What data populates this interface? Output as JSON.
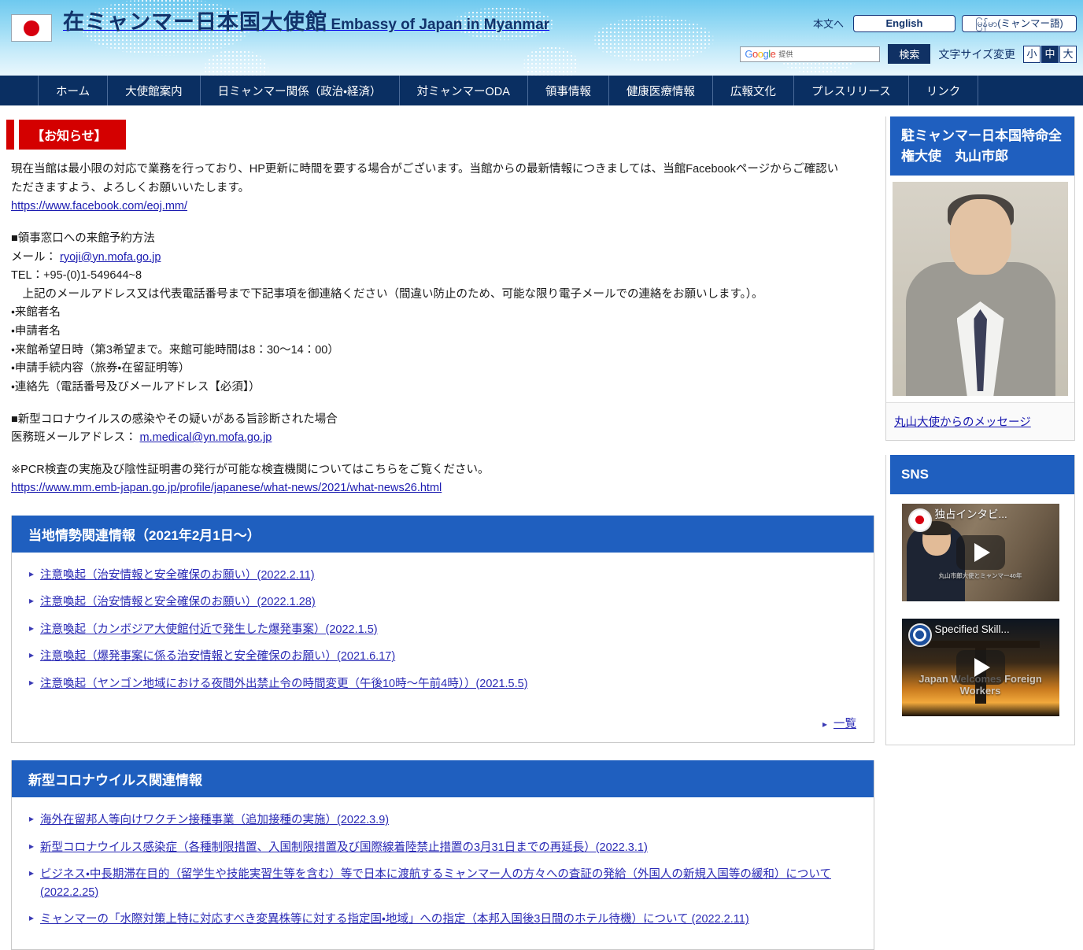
{
  "header": {
    "title_jp": "在ミャンマー日本国大使館",
    "title_en": "Embassy of Japan in Myanmar",
    "skip_link": "本文へ",
    "lang_english": "English",
    "lang_myanmar": "မြန်မာ(ミャンマー語)",
    "search": {
      "engine_label": "Google",
      "engine_sub": "提供",
      "placeholder": "",
      "value": "",
      "button": "検索"
    },
    "font_size": {
      "label": "文字サイズ変更",
      "options": [
        "小",
        "中",
        "大"
      ],
      "selected": "中"
    }
  },
  "nav": {
    "items": [
      "ホーム",
      "大使館案内",
      "日ミャンマー関係（政治・経済）",
      "対ミャンマーODA",
      "領事情報",
      "健康医療情報",
      "広報文化",
      "プレスリリース",
      "リンク"
    ]
  },
  "notice": {
    "badge": "【お知らせ】",
    "para1_line1": "現在当館は最小限の対応で業務を行っており、HP更新に時間を要する場合がございます。当館からの最新情報につきましては、当館Facebookページからご確認い",
    "para1_line2": "ただきますよう、よろしくお願いいたします。",
    "facebook_url": "https://www.facebook.com/eoj.mm/",
    "consular_heading": "■領事窓口への来館予約方法",
    "mail_label": "メール：",
    "mail_address": "ryoji@yn.mofa.go.jp",
    "tel_line": "TEL：+95-(0)1-549644~8",
    "instruction": "上記のメールアドレス又は代表電話番号まで下記事項を御連絡ください（間違い防止のため、可能な限り電子メールでの連絡をお願いします。）。",
    "bullets": [
      "・来館者名",
      "・申請者名",
      "・来館希望日時（第3希望まで。来館可能時間は8：30〜14：00）",
      "・申請手続内容（旅券・在留証明等）",
      "・連絡先（電話番号及びメールアドレス【必須】）"
    ],
    "covid_heading": "■新型コロナウイルスの感染やその疑いがある旨診断された場合",
    "medical_label": "医務班メールアドレス：",
    "medical_address": "m.medical@yn.mofa.go.jp",
    "pcr_note": "※PCR検査の実施及び陰性証明書の発行が可能な検査機関についてはこちらをご覧ください。",
    "pcr_url": "https://www.mm.emb-japan.go.jp/profile/japanese/what-news/2021/what-news26.html"
  },
  "sections": [
    {
      "title": "当地情勢関連情報（2021年2月1日〜）",
      "links": [
        "注意喚起（治安情報と安全確保のお願い）(2022.2.11)",
        "注意喚起（治安情報と安全確保のお願い）(2022.1.28)",
        "注意喚起（カンボジア大使館付近で発生した爆発事案）(2022.1.5)",
        "注意喚起（爆発事案に係る治安情報と安全確保のお願い）(2021.6.17)",
        "注意喚起（ヤンゴン地域における夜間外出禁止令の時間変更（午後10時〜午前4時））(2021.5.5)"
      ],
      "more_label": "一覧"
    },
    {
      "title": "新型コロナウイルス関連情報",
      "links": [
        "海外在留邦人等向けワクチン接種事業（追加接種の実施）(2022.3.9)",
        "新型コロナウイルス感染症（各種制限措置、入国制限措置及び国際線着陸禁止措置の3月31日までの再延長）(2022.3.1)",
        "ビジネス・中長期滞在目的（留学生や技能実習生等を含む）等で日本に渡航するミャンマー人の方々への査証の発給（外国人の新規入国等の緩和）について (2022.2.25)",
        "ミャンマーの「水際対策上特に対応すべき変異株等に対する指定国・地域」への指定（本邦入国後3日間のホテル待機）について (2022.2.11)"
      ],
      "more_label": ""
    }
  ],
  "sidebar": {
    "ambassador": {
      "title": "駐ミャンマー日本国特命全権大使　丸山市郎",
      "message_link": "丸山大使からのメッセージ"
    },
    "sns": {
      "title": "SNS",
      "videos": [
        {
          "title": "独占インタビ...",
          "overlay": "丸山市郎大使とミャンマー40年"
        },
        {
          "title": "Specified Skill...",
          "overlay": "Japan Welcomes Foreign Workers"
        }
      ]
    }
  },
  "colors": {
    "nav_bar": "#0a2f62",
    "section_header": "#1f5fbf",
    "notice_badge": "#d40000",
    "link": "#2a2ab5",
    "header_gradient_top": "#6ec9ef"
  }
}
